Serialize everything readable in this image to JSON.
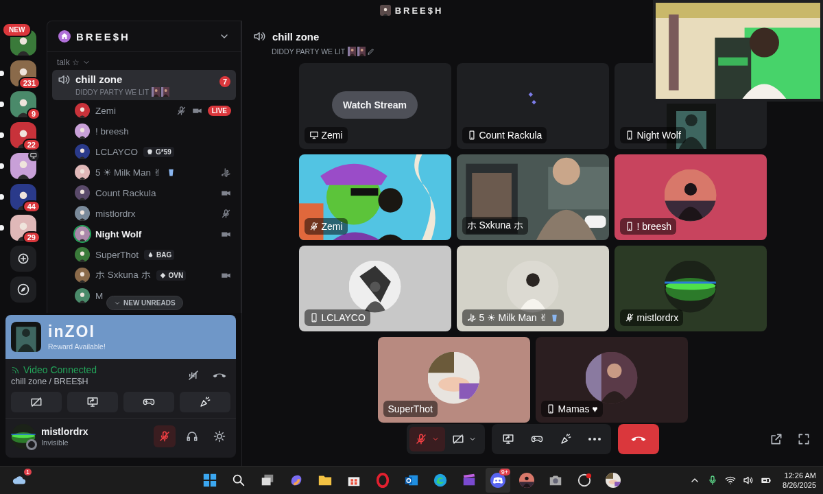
{
  "title_bar": {
    "title": "BREE$H"
  },
  "servers": [
    {
      "label": "NEW",
      "unread": false
    },
    {
      "badge": "231",
      "unread": true
    },
    {
      "badge": "9",
      "unread": true
    },
    {
      "badge": "22",
      "unread": true
    },
    {
      "streaming": true,
      "unread": true
    },
    {
      "badge": "44",
      "unread": true
    },
    {
      "badge": "29",
      "unread": true
    }
  ],
  "sidebar": {
    "server_name": "BREE$H",
    "category": "talk ☆",
    "channel": {
      "name": "chill zone",
      "status": "DIDDY PARTY WE LIT",
      "badge": "7",
      "selected": true
    },
    "members": [
      {
        "name": "Zemi",
        "muted": true,
        "video": true,
        "live": "LIVE"
      },
      {
        "name": "! breesh"
      },
      {
        "name": "LCLAYCO",
        "tag": {
          "kind": "skull",
          "text": "G*59"
        }
      },
      {
        "name": "5 ☀ Milk Man ✌",
        "cup": true,
        "console": true
      },
      {
        "name": "Count Rackula",
        "video": true
      },
      {
        "name": "mistlordrx",
        "muted": true
      },
      {
        "name": "Night Wolf",
        "video": true,
        "speaking": true
      },
      {
        "name": "SuperThot",
        "tag": {
          "kind": "drop",
          "text": "BAG"
        }
      },
      {
        "name": "ホ Sxkuna ホ",
        "tag": {
          "kind": "diamond",
          "text": "OVN"
        },
        "video": true
      },
      {
        "name": "M"
      }
    ],
    "new_unreads": "NEW UNREADS"
  },
  "promo": {
    "title": "inZOI",
    "subtitle": "Reward Available!"
  },
  "voice": {
    "status": "Video Connected",
    "location": "chill zone / BREE$H"
  },
  "user": {
    "name": "mistlordrx",
    "status": "Invisible",
    "muted": true
  },
  "main": {
    "channel": "chill zone",
    "status": "DIDDY PARTY WE LIT",
    "rows": [
      [
        {
          "kind": "stream",
          "button": "Watch Stream",
          "label": {
            "kind": "screen",
            "name": "Zemi"
          }
        },
        {
          "kind": "loading",
          "label": {
            "kind": "mobile",
            "name": "Count Rackula"
          }
        },
        {
          "kind": "video",
          "label": {
            "kind": "mobile",
            "name": "Night Wolf"
          }
        }
      ],
      [
        {
          "kind": "video",
          "label": {
            "kind": "muted",
            "name": "Zemi"
          }
        },
        {
          "kind": "video",
          "label": {
            "kind": "plain",
            "name": "ホ Sxkuna ホ"
          }
        },
        {
          "kind": "avatar",
          "color": "#c8445e",
          "label": {
            "kind": "mobile",
            "name": "! breesh"
          }
        }
      ],
      [
        {
          "kind": "avatar",
          "color": "#c8c8c8",
          "label": {
            "kind": "mobile",
            "name": "LCLAYCO"
          }
        },
        {
          "kind": "avatar",
          "color": "#d3d2c8",
          "cup": true,
          "label": {
            "kind": "console",
            "name": "5 ☀ Milk Man ✌"
          }
        },
        {
          "kind": "avatar",
          "color": "#2b3a25",
          "label": {
            "kind": "muted",
            "name": "mistlordrx"
          }
        }
      ],
      [
        {
          "kind": "avatar",
          "color": "#b88a80",
          "label": {
            "kind": "plain",
            "name": "SuperThot"
          }
        },
        {
          "kind": "avatar",
          "color": "#2b1e20",
          "label": {
            "kind": "mobile",
            "name": "Mamas ♥"
          }
        }
      ]
    ]
  },
  "controls": {
    "mic_muted": true
  },
  "taskbar": {
    "weather_badge": "1",
    "chat_badge": "9+",
    "time": "12:26 AM",
    "date": "8/26/2025"
  }
}
